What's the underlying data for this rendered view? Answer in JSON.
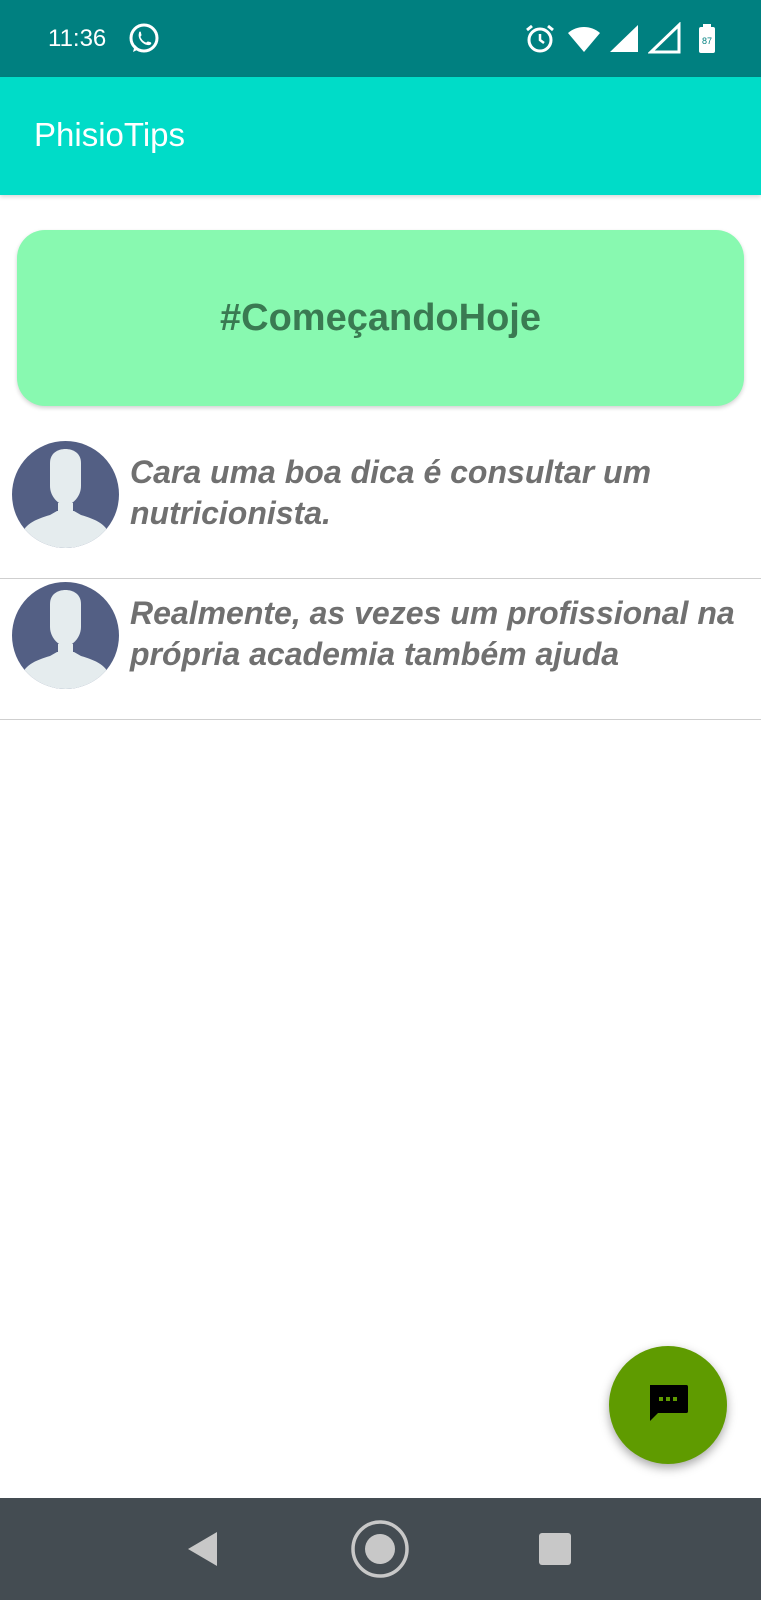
{
  "status_bar": {
    "time": "11:36",
    "icons": [
      "whatsapp-icon",
      "alarm-icon",
      "wifi-icon",
      "signal-icon",
      "signal-icon",
      "battery-icon"
    ],
    "battery_label": "87"
  },
  "app_bar": {
    "title": "PhisioTips"
  },
  "tag_card": {
    "label": "#ComeçandoHoje"
  },
  "comments": [
    {
      "text": "Cara uma boa dica é consultar um nutricionista."
    },
    {
      "text": "Realmente, as vezes um profissional na própria academia também ajuda"
    }
  ],
  "fab": {
    "icon": "chat-icon"
  },
  "nav_bar": {
    "buttons": [
      "back-icon",
      "home-icon",
      "recents-icon"
    ]
  },
  "colors": {
    "status_bar": "#008080",
    "app_bar": "#00dcc8",
    "tag_card": "#88f9b0",
    "tag_text": "#3a7a52",
    "comment_text": "#707070",
    "fab": "#5f9b00",
    "nav_bar": "#444c52"
  }
}
